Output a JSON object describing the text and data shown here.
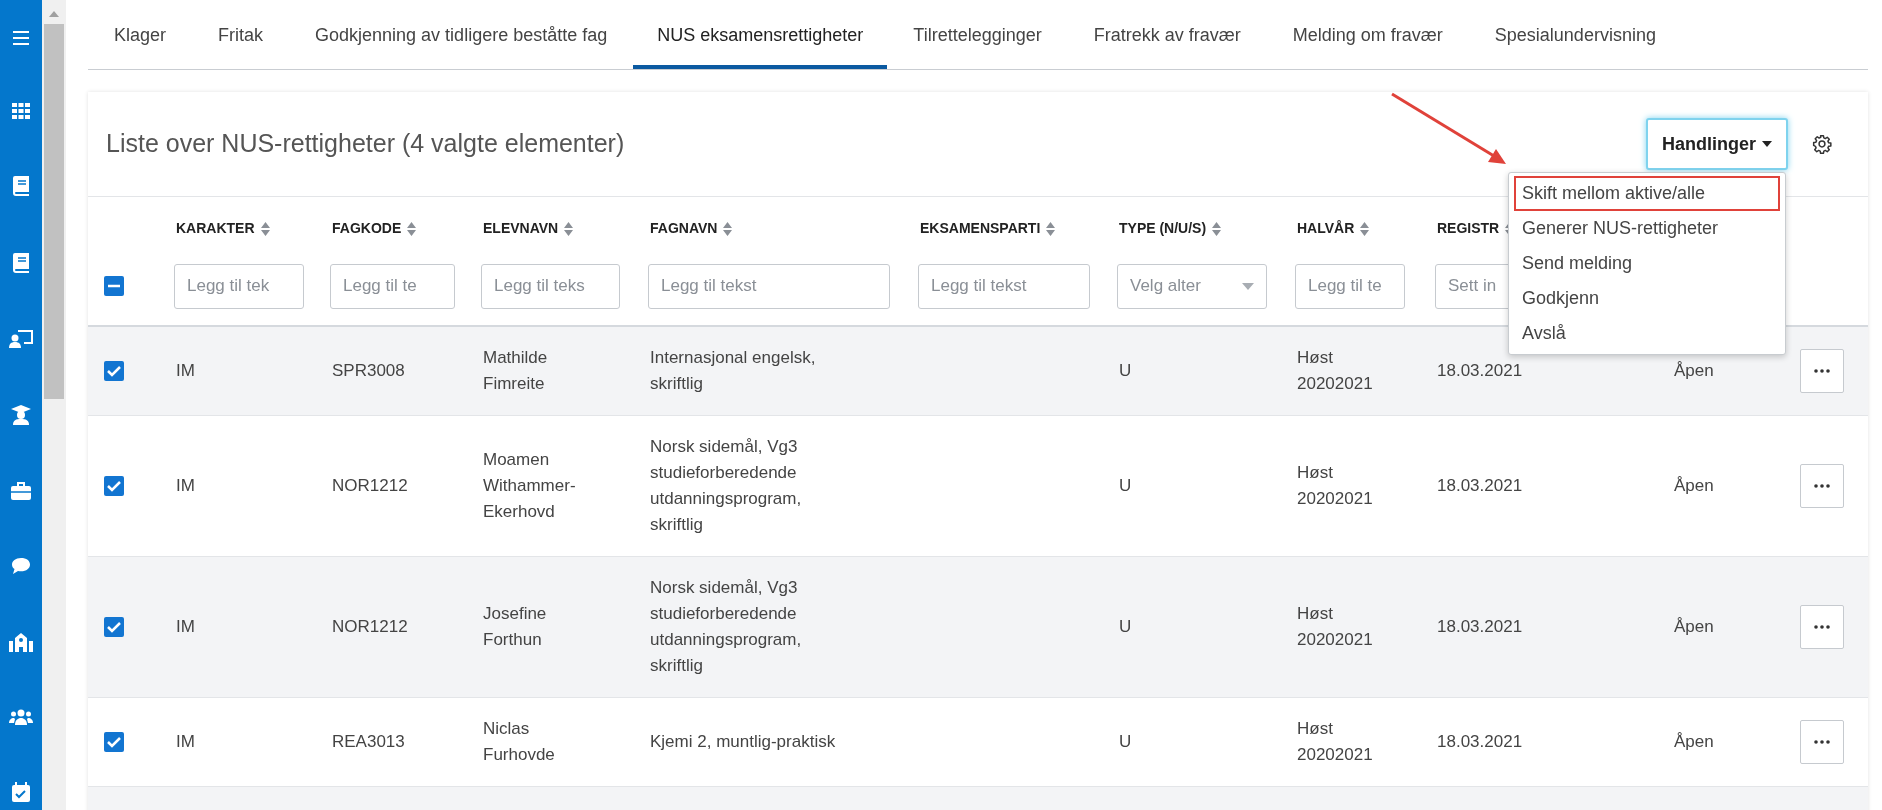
{
  "tabs": [
    {
      "label": "Klager",
      "selected": false
    },
    {
      "label": "Fritak",
      "selected": false
    },
    {
      "label": "Godkjenning av tidligere beståtte fag",
      "selected": false
    },
    {
      "label": "NUS eksamensrettigheter",
      "selected": true
    },
    {
      "label": "Tilrettelegginger",
      "selected": false
    },
    {
      "label": "Fratrekk av fravær",
      "selected": false
    },
    {
      "label": "Melding om fravær",
      "selected": false
    },
    {
      "label": "Spesialundervisning",
      "selected": false
    }
  ],
  "panel": {
    "title": "Liste over NUS-rettigheter (4 valgte elementer)",
    "actions_button": "Handlinger",
    "actions_menu": [
      {
        "label": "Skift mellom aktive/alle",
        "annotated": true
      },
      {
        "label": "Generer NUS-rettigheter",
        "annotated": false
      },
      {
        "label": "Send melding",
        "annotated": false
      },
      {
        "label": "Godkjenn",
        "annotated": false
      },
      {
        "label": "Avslå",
        "annotated": false
      }
    ]
  },
  "table": {
    "select_all": {
      "indeterminate": true
    },
    "columns": [
      {
        "label": "KARAKTER",
        "filter": {
          "kind": "text",
          "placeholder": "Legg til tek"
        }
      },
      {
        "label": "FAGKODE",
        "filter": {
          "kind": "text",
          "placeholder": "Legg til te"
        }
      },
      {
        "label": "ELEVNAVN",
        "filter": {
          "kind": "text",
          "placeholder": "Legg til teks"
        }
      },
      {
        "label": "FAGNAVN",
        "filter": {
          "kind": "text",
          "placeholder": "Legg til tekst"
        }
      },
      {
        "label": "EKSAMENSPARTI",
        "filter": {
          "kind": "text",
          "placeholder": "Legg til tekst"
        }
      },
      {
        "label": "TYPE (N/U/S)",
        "filter": {
          "kind": "select",
          "placeholder": "Velg alter"
        }
      },
      {
        "label": "HALVÅR",
        "filter": {
          "kind": "text",
          "placeholder": "Legg til te"
        }
      },
      {
        "label": "REGISTR",
        "filter": {
          "kind": "text",
          "placeholder": "Sett in"
        }
      }
    ],
    "rows": [
      {
        "selected": true,
        "karakter": "IM",
        "fagkode": "SPR3008",
        "elevnavn": "Mathilde Fimreite",
        "fagnavn": "Internasjonal engelsk, skriftlig",
        "type": "U",
        "halvar": "Høst 20202021",
        "registrert": "18.03.2021",
        "column_9": "Åpen"
      },
      {
        "selected": true,
        "karakter": "IM",
        "fagkode": "NOR1212",
        "elevnavn": "Moamen Withammer-Ekerhovd",
        "fagnavn": "Norsk sidemål, Vg3 studieforberedende utdanningsprogram, skriftlig",
        "type": "U",
        "halvar": "Høst 20202021",
        "registrert": "18.03.2021",
        "column_9": "Åpen"
      },
      {
        "selected": true,
        "karakter": "IM",
        "fagkode": "NOR1212",
        "elevnavn": "Josefine Forthun",
        "fagnavn": "Norsk sidemål, Vg3 studieforberedende utdanningsprogram, skriftlig",
        "type": "U",
        "halvar": "Høst 20202021",
        "registrert": "18.03.2021",
        "column_9": "Åpen"
      },
      {
        "selected": true,
        "karakter": "IM",
        "fagkode": "REA3013",
        "elevnavn": "Niclas Furhovde",
        "fagnavn": "Kjemi 2, muntlig-praktisk",
        "type": "U",
        "halvar": "Høst 20202021",
        "registrert": "18.03.2021",
        "column_9": "Åpen"
      }
    ]
  }
}
